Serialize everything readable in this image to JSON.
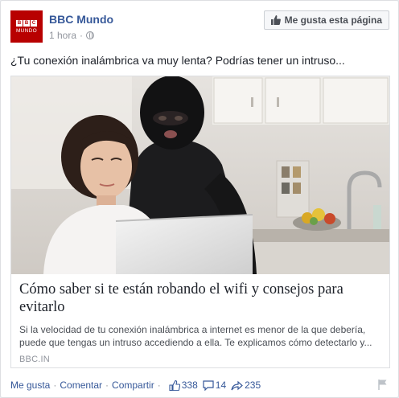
{
  "page": {
    "logo_badge": "BBC",
    "logo_text": "MUNDO",
    "name": "BBC Mundo",
    "time": "1 hora",
    "like_page_label": "Me gusta esta página"
  },
  "post": {
    "text": "¿Tu conexión inalámbrica va muy lenta? Podrías tener un intruso..."
  },
  "link": {
    "title": "Cómo saber si te están robando el wifi y consejos para evitarlo",
    "description": "Si la velocidad de tu conexión inalámbrica a internet es menor de la que debería, puede que tengas un intruso accediendo a ella. Te explicamos cómo detectarlo y...",
    "domain": "BBC.IN"
  },
  "actions": {
    "like": "Me gusta",
    "comment": "Comentar",
    "share": "Compartir",
    "likes_count": "338",
    "comments_count": "14",
    "shares_count": "235"
  },
  "icons": [
    "globe-icon",
    "thumbs-up-icon",
    "comment-icon",
    "share-icon",
    "flag-icon"
  ]
}
